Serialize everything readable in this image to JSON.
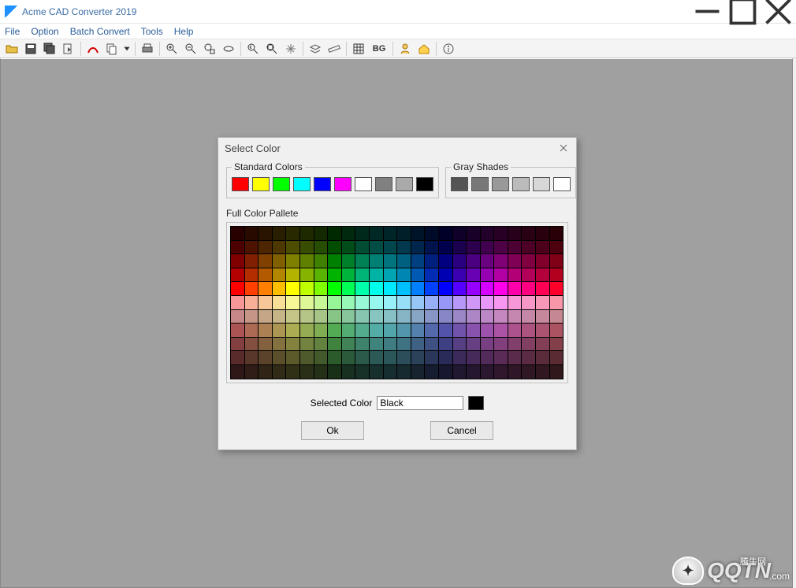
{
  "window": {
    "title": "Acme CAD Converter 2019"
  },
  "menu": {
    "items": [
      "File",
      "Option",
      "Batch Convert",
      "Tools",
      "Help"
    ]
  },
  "toolbar": {
    "bg_label": "BG"
  },
  "dialog": {
    "title": "Select Color",
    "standard_label": "Standard Colors",
    "gray_label": "Gray Shades",
    "full_label": "Full Color Pallete",
    "selected_label": "Selected Color",
    "selected_value": "Black",
    "ok": "Ok",
    "cancel": "Cancel",
    "standard_colors": [
      "#ff0000",
      "#ffff00",
      "#00ff00",
      "#00ffff",
      "#0000ff",
      "#ff00ff",
      "#ffffff",
      "#808080",
      "#aaaaaa",
      "#000000"
    ],
    "gray_shades": [
      "#555555",
      "#777777",
      "#999999",
      "#bbbbbb",
      "#d7d7d7",
      "#ffffff"
    ]
  },
  "watermark": {
    "brand": "QQTN",
    "suffix": ".com",
    "cn": "腾牛网"
  }
}
